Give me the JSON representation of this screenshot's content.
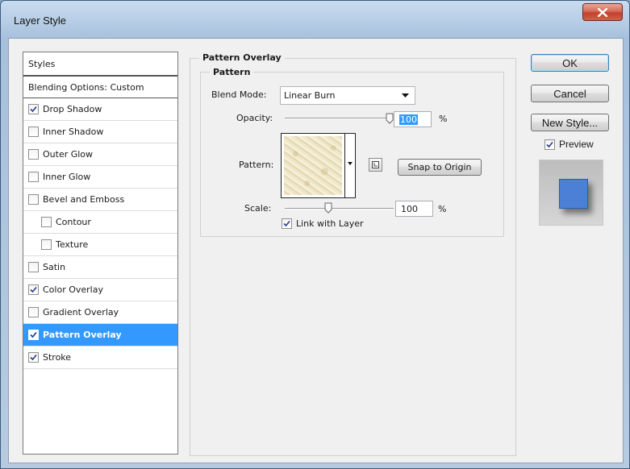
{
  "window": {
    "title": "Layer Style",
    "close_glyph": "x"
  },
  "styles": {
    "header": "Styles",
    "blending_options": "Blending Options: Custom",
    "items": [
      {
        "label": "Drop Shadow",
        "checked": true,
        "indent": false,
        "selected": false
      },
      {
        "label": "Inner Shadow",
        "checked": false,
        "indent": false,
        "selected": false
      },
      {
        "label": "Outer Glow",
        "checked": false,
        "indent": false,
        "selected": false
      },
      {
        "label": "Inner Glow",
        "checked": false,
        "indent": false,
        "selected": false
      },
      {
        "label": "Bevel and Emboss",
        "checked": false,
        "indent": false,
        "selected": false
      },
      {
        "label": "Contour",
        "checked": false,
        "indent": true,
        "selected": false
      },
      {
        "label": "Texture",
        "checked": false,
        "indent": true,
        "selected": false
      },
      {
        "label": "Satin",
        "checked": false,
        "indent": false,
        "selected": false
      },
      {
        "label": "Color Overlay",
        "checked": true,
        "indent": false,
        "selected": false
      },
      {
        "label": "Gradient Overlay",
        "checked": false,
        "indent": false,
        "selected": false
      },
      {
        "label": "Pattern Overlay",
        "checked": true,
        "indent": false,
        "selected": true
      },
      {
        "label": "Stroke",
        "checked": true,
        "indent": false,
        "selected": false
      }
    ]
  },
  "pattern_overlay": {
    "section_title": "Pattern Overlay",
    "subsection_title": "Pattern",
    "blend_mode_label": "Blend Mode:",
    "blend_mode_value": "Linear Burn",
    "opacity_label": "Opacity:",
    "opacity_value": "100",
    "opacity_unit": "%",
    "opacity_slider_fraction": 1.0,
    "pattern_label": "Pattern:",
    "snap_button": "Snap to Origin",
    "scale_label": "Scale:",
    "scale_value": "100",
    "scale_unit": "%",
    "scale_slider_fraction": 0.4,
    "link_with_layer_label": "Link with Layer",
    "link_with_layer_checked": true
  },
  "actions": {
    "ok": "OK",
    "cancel": "Cancel",
    "new_style": "New Style...",
    "preview_label": "Preview",
    "preview_checked": true
  },
  "colors": {
    "selection": "#3399ff",
    "preview_square": "#4c80d6",
    "close_button": "#c2412c"
  }
}
